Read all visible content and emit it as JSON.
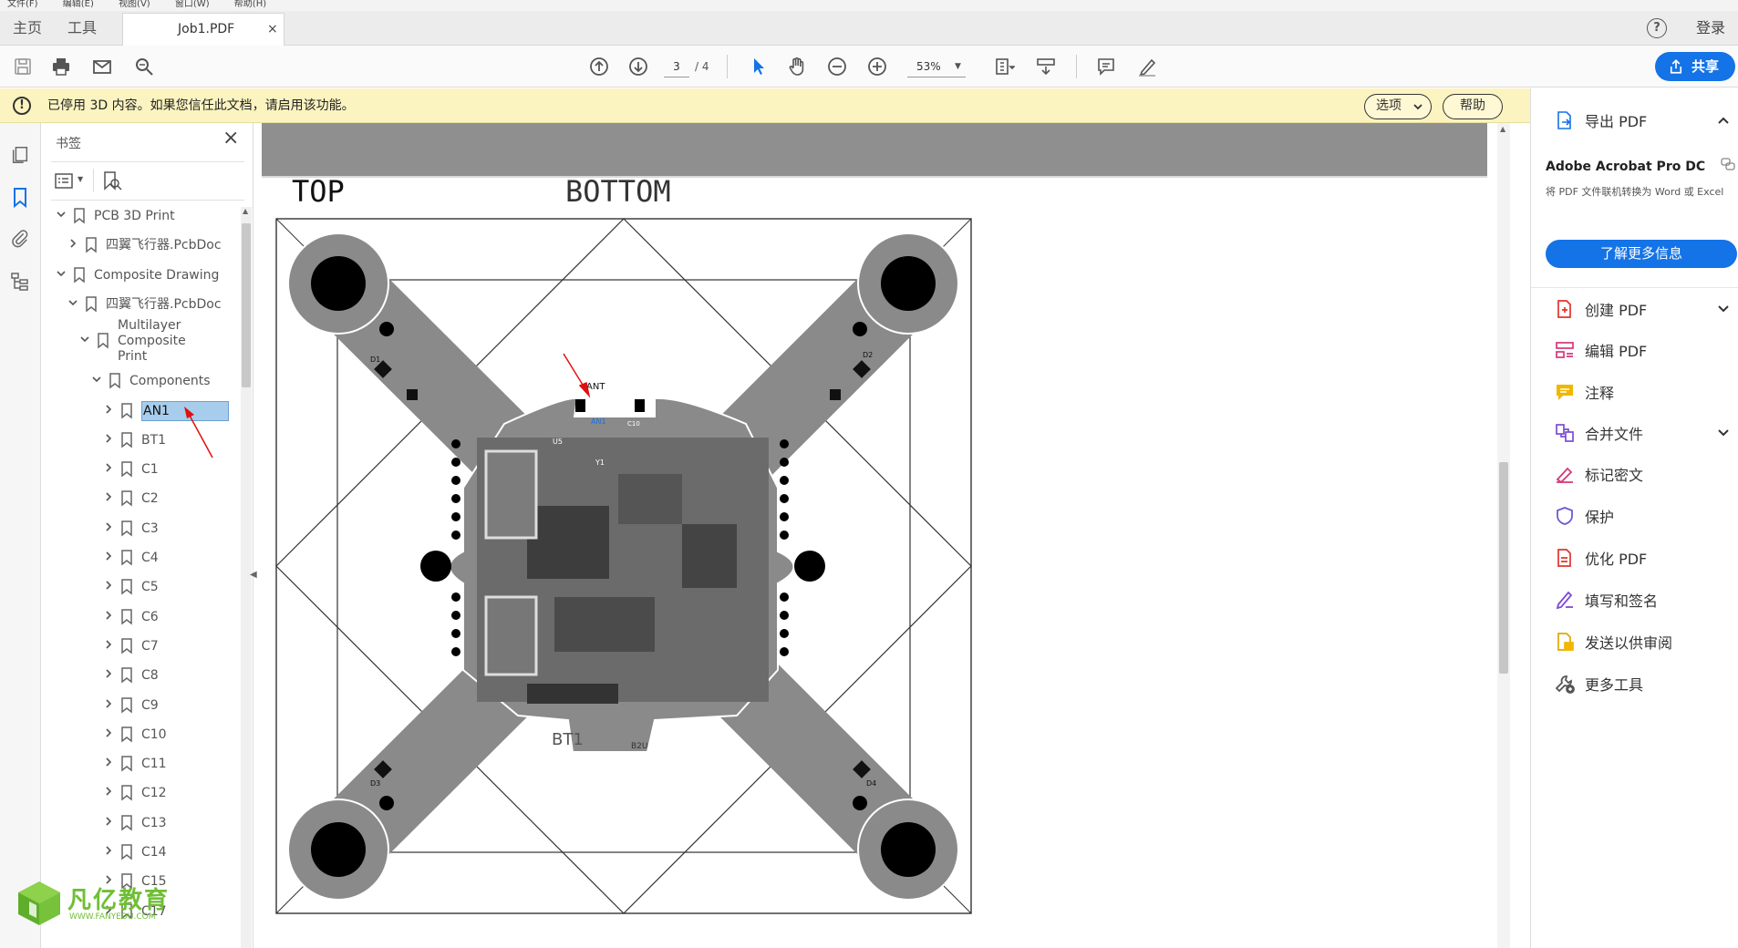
{
  "menu": [
    "文件(F)",
    "编辑(E)",
    "视图(V)",
    "窗口(W)",
    "帮助(H)"
  ],
  "tabs": {
    "home": "主页",
    "tools": "工具",
    "document": "Job1.PDF",
    "close": "×"
  },
  "account": {
    "help": "?",
    "login": "登录"
  },
  "toolbar": {
    "page_current": "3",
    "page_total": "/ 4",
    "zoom": "53%",
    "share": "共享"
  },
  "notice": {
    "text": "已停用 3D 内容。如果您信任此文档，请启用该功能。",
    "options": "选项",
    "help": "帮助"
  },
  "bookmarks": {
    "title": "书签",
    "close": "×",
    "items": [
      {
        "label": "PCB 3D Print",
        "chev": "v",
        "level": 0
      },
      {
        "label": "四翼飞行器.PcbDoc",
        "chev": ">",
        "level": 1
      },
      {
        "label": "Composite Drawing",
        "chev": "v",
        "level": 0
      },
      {
        "label": "四翼飞行器.PcbDoc",
        "chev": "v",
        "level": 1
      },
      {
        "label": "Multilayer Composite Print",
        "chev": "v",
        "level": 2
      },
      {
        "label": "Components",
        "chev": "v",
        "level": 3
      },
      {
        "label": "AN1",
        "chev": ">",
        "level": 4,
        "selected": true
      },
      {
        "label": "BT1",
        "chev": ">",
        "level": 4
      },
      {
        "label": "C1",
        "chev": ">",
        "level": 4
      },
      {
        "label": "C2",
        "chev": ">",
        "level": 4
      },
      {
        "label": "C3",
        "chev": ">",
        "level": 4
      },
      {
        "label": "C4",
        "chev": ">",
        "level": 4
      },
      {
        "label": "C5",
        "chev": ">",
        "level": 4
      },
      {
        "label": "C6",
        "chev": ">",
        "level": 4
      },
      {
        "label": "C7",
        "chev": ">",
        "level": 4
      },
      {
        "label": "C8",
        "chev": ">",
        "level": 4
      },
      {
        "label": "C9",
        "chev": ">",
        "level": 4
      },
      {
        "label": "C10",
        "chev": ">",
        "level": 4
      },
      {
        "label": "C11",
        "chev": ">",
        "level": 4
      },
      {
        "label": "C12",
        "chev": ">",
        "level": 4
      },
      {
        "label": "C13",
        "chev": ">",
        "level": 4
      },
      {
        "label": "C14",
        "chev": ">",
        "level": 4
      },
      {
        "label": "C15",
        "chev": ">",
        "level": 4
      },
      {
        "label": "C17",
        "chev": ">",
        "level": 4
      }
    ]
  },
  "pcb": {
    "top_label": "TOP",
    "bottom_label": "BOTTOM",
    "labels": {
      "ant": "ANT",
      "an1": "AN1",
      "bt1": "BT1",
      "b2u": "B2U",
      "u5": "U5",
      "d1": "D1",
      "d2": "D2",
      "d3": "D3",
      "d4": "D4",
      "y1": "Y1",
      "c10": "C10"
    }
  },
  "right_panel": {
    "export": "导出 PDF",
    "product": "Adobe Acrobat Pro DC",
    "desc": "将 PDF 文件联机转换为 Word 或 Excel",
    "learn_more": "了解更多信息",
    "tools": [
      "创建 PDF",
      "编辑 PDF",
      "注释",
      "合并文件",
      "标记密文",
      "保护",
      "优化 PDF",
      "填写和签名",
      "发送以供审阅",
      "更多工具"
    ]
  },
  "watermark": {
    "cn": "凡亿教育",
    "en": "WWW.FANYEDU.COM"
  },
  "colors": {
    "accent": "#1473e6",
    "notice_bg": "#fbf4c0",
    "selection": "#a8cdec",
    "pcb_gray": "#8a8a8a"
  }
}
